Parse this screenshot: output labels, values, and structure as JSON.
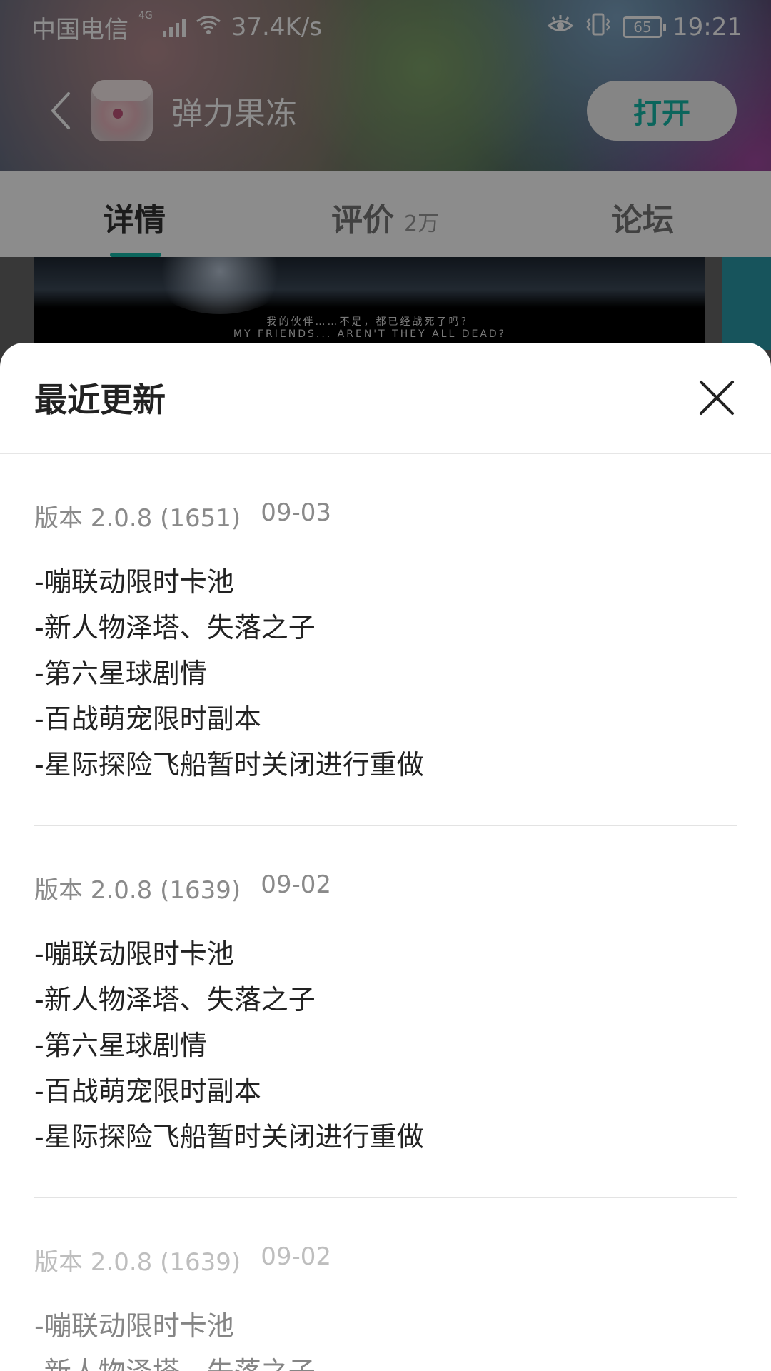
{
  "status_bar": {
    "carrier": "中国电信",
    "network_type": "4G",
    "speed": "37.4K/s",
    "battery": "65",
    "time": "19:21"
  },
  "app_bar": {
    "app_name": "弹力果冻",
    "open_label": "打开"
  },
  "tabs": [
    {
      "label": "详情",
      "count": ""
    },
    {
      "label": "评价",
      "count": "2万"
    },
    {
      "label": "论坛",
      "count": ""
    }
  ],
  "screenshot": {
    "caption_cn": "我的伙伴……不是，都已经战死了吗？",
    "caption_en": "MY FRIENDS... AREN'T THEY ALL DEAD?"
  },
  "sheet": {
    "title": "最近更新",
    "versions": [
      {
        "version": "版本 2.0.8 (1651)",
        "date": "09-03",
        "changes": [
          "-嘣联动限时卡池",
          "-新人物泽塔、失落之子",
          "-第六星球剧情",
          "-百战萌宠限时副本",
          "-星际探险飞船暂时关闭进行重做"
        ]
      },
      {
        "version": "版本 2.0.8 (1639)",
        "date": "09-02",
        "changes": [
          "-嘣联动限时卡池",
          "-新人物泽塔、失落之子",
          "-第六星球剧情",
          "-百战萌宠限时副本",
          "-星际探险飞船暂时关闭进行重做"
        ]
      },
      {
        "version": "版本 2.0.8 (1639)",
        "date": "09-02",
        "changes": [
          "-嘣联动限时卡池",
          "-新人物泽塔、失落之子"
        ]
      }
    ]
  },
  "colors": {
    "accent": "#14b9a8",
    "sheet_bg": "#ffffff",
    "meta_text": "#8a8a8a"
  }
}
